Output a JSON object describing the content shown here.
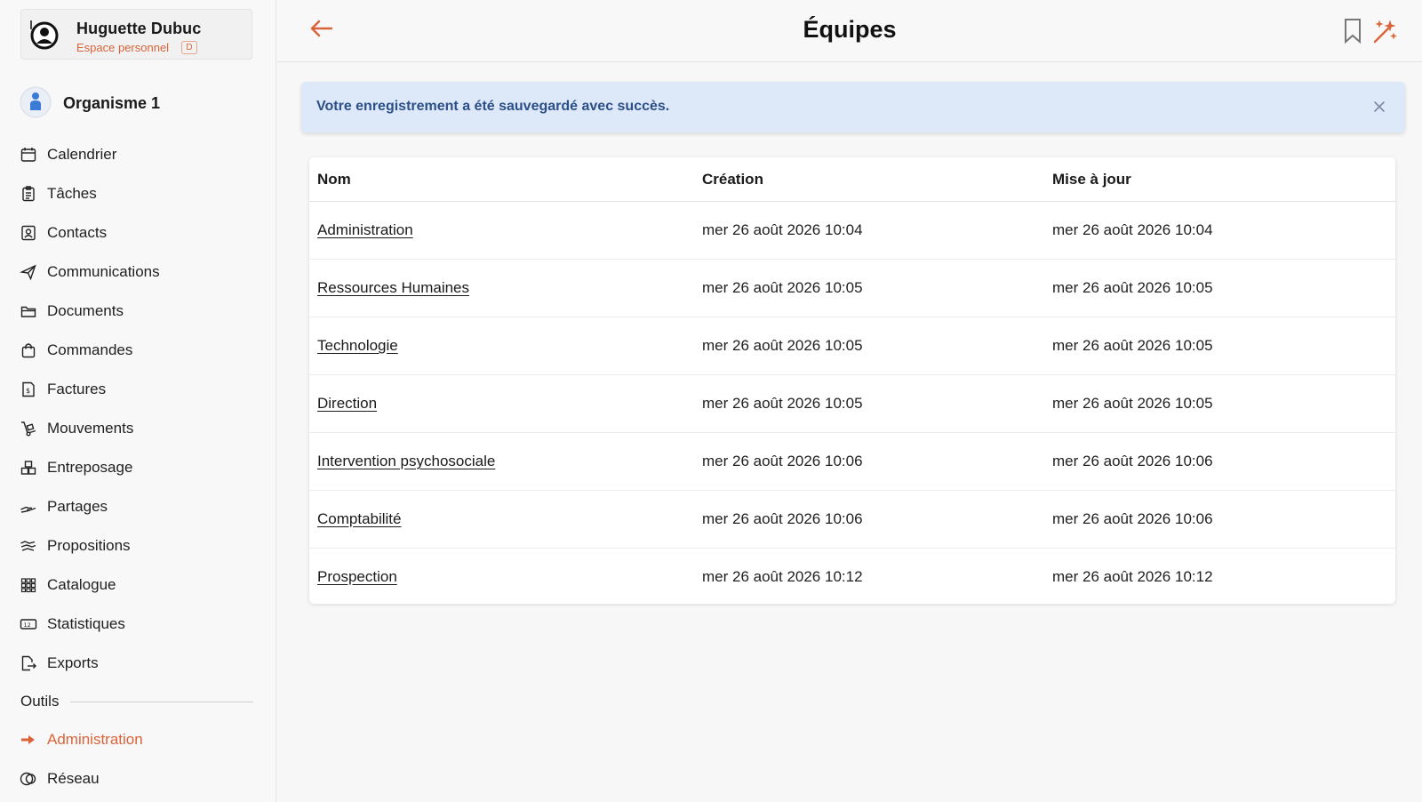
{
  "user": {
    "name": "Huguette Dubuc",
    "space": "Espace personnel",
    "badge": "D"
  },
  "organization": {
    "label": "Organisme 1"
  },
  "nav": [
    {
      "label": "Calendrier",
      "icon": "calendar-icon"
    },
    {
      "label": "Tâches",
      "icon": "clipboard-icon"
    },
    {
      "label": "Contacts",
      "icon": "contact-card-icon"
    },
    {
      "label": "Communications",
      "icon": "paper-plane-icon"
    },
    {
      "label": "Documents",
      "icon": "folder-icon"
    },
    {
      "label": "Commandes",
      "icon": "shopping-bag-icon"
    },
    {
      "label": "Factures",
      "icon": "invoice-icon"
    },
    {
      "label": "Mouvements",
      "icon": "hand-truck-icon"
    },
    {
      "label": "Entreposage",
      "icon": "warehouse-boxes-icon"
    },
    {
      "label": "Partages",
      "icon": "hand-share-icon"
    },
    {
      "label": "Propositions",
      "icon": "handshake-icon"
    },
    {
      "label": "Catalogue",
      "icon": "grid-catalog-icon"
    },
    {
      "label": "Statistiques",
      "icon": "stats-counter-icon"
    },
    {
      "label": "Exports",
      "icon": "export-file-icon"
    }
  ],
  "tools": {
    "section_label": "Outils",
    "items": [
      {
        "label": "Administration",
        "icon": "arrow-right-icon",
        "active": true
      },
      {
        "label": "Réseau",
        "icon": "network-circles-icon",
        "active": false
      }
    ]
  },
  "header": {
    "title": "Équipes"
  },
  "alert": {
    "message": "Votre enregistrement a été sauvegardé avec succès."
  },
  "table": {
    "columns": [
      "Nom",
      "Création",
      "Mise à jour"
    ],
    "rows": [
      {
        "name": "Administration",
        "created": "mer 26 août 2026 10:04",
        "updated": "mer 26 août 2026 10:04"
      },
      {
        "name": "Ressources Humaines",
        "created": "mer 26 août 2026 10:05",
        "updated": "mer 26 août 2026 10:05"
      },
      {
        "name": "Technologie",
        "created": "mer 26 août 2026 10:05",
        "updated": "mer 26 août 2026 10:05"
      },
      {
        "name": "Direction",
        "created": "mer 26 août 2026 10:05",
        "updated": "mer 26 août 2026 10:05"
      },
      {
        "name": "Intervention psychosociale",
        "created": "mer 26 août 2026 10:06",
        "updated": "mer 26 août 2026 10:06"
      },
      {
        "name": "Comptabilité",
        "created": "mer 26 août 2026 10:06",
        "updated": "mer 26 août 2026 10:06"
      },
      {
        "name": "Prospection",
        "created": "mer 26 août 2026 10:12",
        "updated": "mer 26 août 2026 10:12"
      }
    ]
  },
  "colors": {
    "accent": "#d9643a",
    "alert_bg": "#dde9f9",
    "alert_text": "#2c4f88",
    "org_icon": "#3a7bd5"
  }
}
